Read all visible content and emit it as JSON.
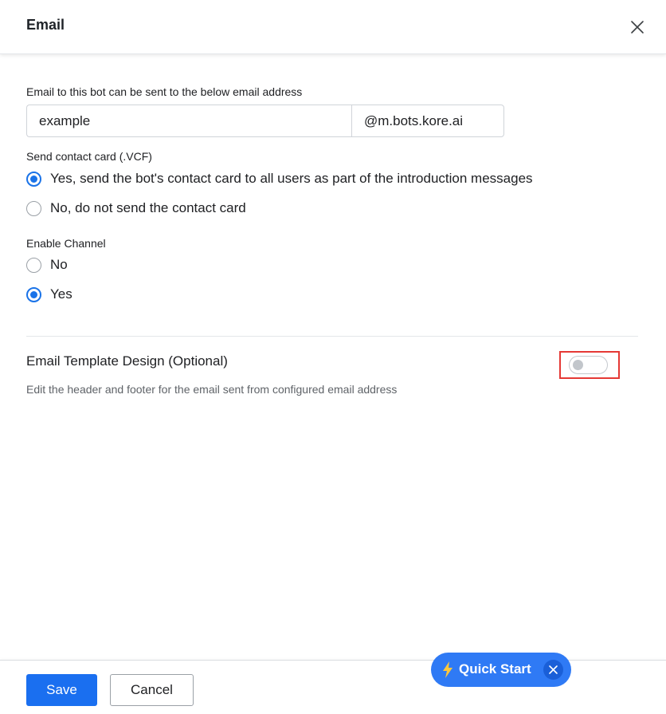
{
  "header": {
    "title": "Email"
  },
  "email": {
    "label": "Email to this bot can be sent to the below email address",
    "value": "example",
    "domain": "@m.bots.kore.ai"
  },
  "contact_card": {
    "label": "Send contact card (.VCF)",
    "options": [
      {
        "label": "Yes, send the bot's contact card to all users as part of the introduction messages",
        "checked": true
      },
      {
        "label": "No, do not send the contact card",
        "checked": false
      }
    ]
  },
  "enable_channel": {
    "label": "Enable Channel",
    "options": [
      {
        "label": "No",
        "checked": false
      },
      {
        "label": "Yes",
        "checked": true
      }
    ]
  },
  "template_design": {
    "title": "Email Template Design (Optional)",
    "description": "Edit the header and footer for the email sent from configured email address",
    "enabled": false
  },
  "footer": {
    "save_label": "Save",
    "cancel_label": "Cancel"
  },
  "quick_start": {
    "label": "Quick Start"
  },
  "colors": {
    "primary": "#1a6ff0",
    "highlight": "#e53935",
    "quick_start_bg": "#2f7af5"
  },
  "icons": {
    "close": "close-icon",
    "bolt": "bolt-icon"
  }
}
